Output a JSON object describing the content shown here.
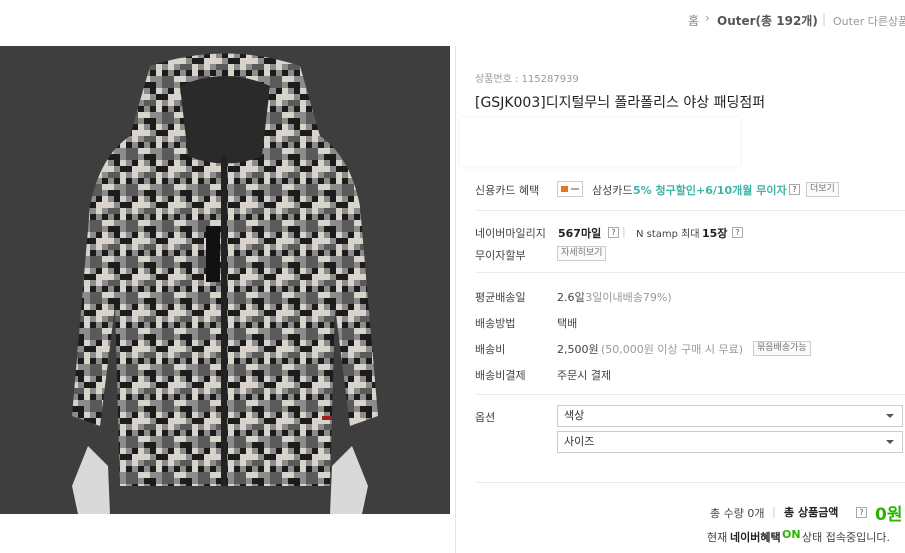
{
  "breadcrumb": {
    "home": "홈",
    "category": "Outer(총 192개)",
    "other": "Outer 다른상품보기"
  },
  "product": {
    "number_label": "상품번호 : 115287939",
    "title": "[GSJK003]디지털무늬 폴라폴리스 야상 패딩점퍼"
  },
  "card": {
    "label": "신용카드 혜택",
    "card_name": "삼성카드",
    "benefit": "5% 청구할인+6/10개월 무이자",
    "more_button": "더보기"
  },
  "mileage": {
    "label": "네이버마일리지",
    "value": "567마일",
    "stamp_label": "N stamp 최대",
    "stamp_value": "15장"
  },
  "installment": {
    "label": "무이자할부",
    "detail_button": "자세히보기"
  },
  "delivery": {
    "avg_label": "평균배송일",
    "avg_value": "2.6일",
    "avg_note": "(3일이내배송79%)",
    "method_label": "배송방법",
    "method_value": "택배",
    "fee_label": "배송비",
    "fee_value": "2,500원",
    "fee_note": "(50,000원 이상 구매 시 무료)",
    "bundle_button": "묶음배송가능",
    "payment_label": "배송비결제",
    "payment_value": "주문시 결제"
  },
  "options": {
    "label": "옵션",
    "color_select": "색상",
    "size_select": "사이즈"
  },
  "total": {
    "quantity_text": "총 수량 0개",
    "amount_label": "총 상품금액",
    "amount_value": "0원"
  },
  "naver": {
    "prefix": "현재",
    "brand": "네이버혜택",
    "on": "ON",
    "suffix": "상태 접속중입니다."
  },
  "colors": {
    "accent_green": "#2db400",
    "benefit_teal": "#3fb5a8",
    "card_orange": "#e8751a"
  }
}
